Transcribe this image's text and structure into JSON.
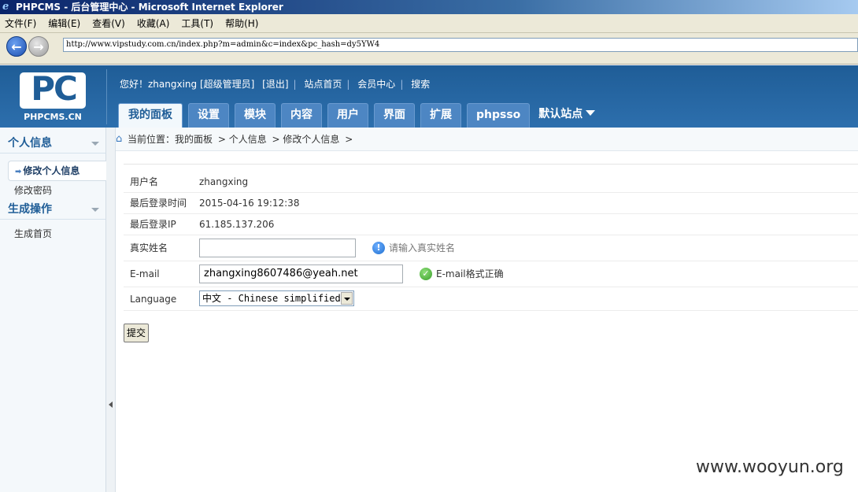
{
  "window": {
    "title": "PHPCMS - 后台管理中心 - Microsoft Internet Explorer",
    "menu": [
      "文件(F)",
      "编辑(E)",
      "查看(V)",
      "收藏(A)",
      "工具(T)",
      "帮助(H)"
    ],
    "url": "http://www.vipstudy.com.cn/index.php?m=admin&c=index&pc_hash=dy5YW4"
  },
  "header": {
    "logo_text": "PC",
    "logo_site": "PHPCMS.CN",
    "greeting": "您好！zhangxing [超级管理员]",
    "links": [
      "[退出]",
      "站点首页",
      "会员中心",
      "搜索"
    ],
    "tabs": [
      "我的面板",
      "设置",
      "模块",
      "内容",
      "用户",
      "界面",
      "扩展",
      "phpsso"
    ],
    "site_selector": "默认站点"
  },
  "sidebar": {
    "section1": "个人信息",
    "active_item": "修改个人信息",
    "item_password": "修改密码",
    "section2": "生成操作",
    "item_home": "生成首页"
  },
  "breadcrumb": {
    "prefix": "当前位置：我的面板",
    "parts": [
      "> 个人信息",
      "> 修改个人信息",
      ">"
    ]
  },
  "form": {
    "username_label": "用户名",
    "username": "zhangxing",
    "lastlogin_time_label": "最后登录时间",
    "lastlogin_time": "2015-04-16 19:12:38",
    "lastlogin_ip_label": "最后登录IP",
    "lastlogin_ip": "61.185.137.206",
    "realname_label": "真实姓名",
    "realname_value": "",
    "realname_hint": "请输入真实姓名",
    "email_label": "E-mail",
    "email_value": "zhangxing8607486@yeah.net",
    "email_hint": "E-mail格式正确",
    "language_label": "Language",
    "language_value": "中文 - Chinese simplified",
    "submit_label": "提交"
  },
  "watermark": "www.wooyun.org"
}
